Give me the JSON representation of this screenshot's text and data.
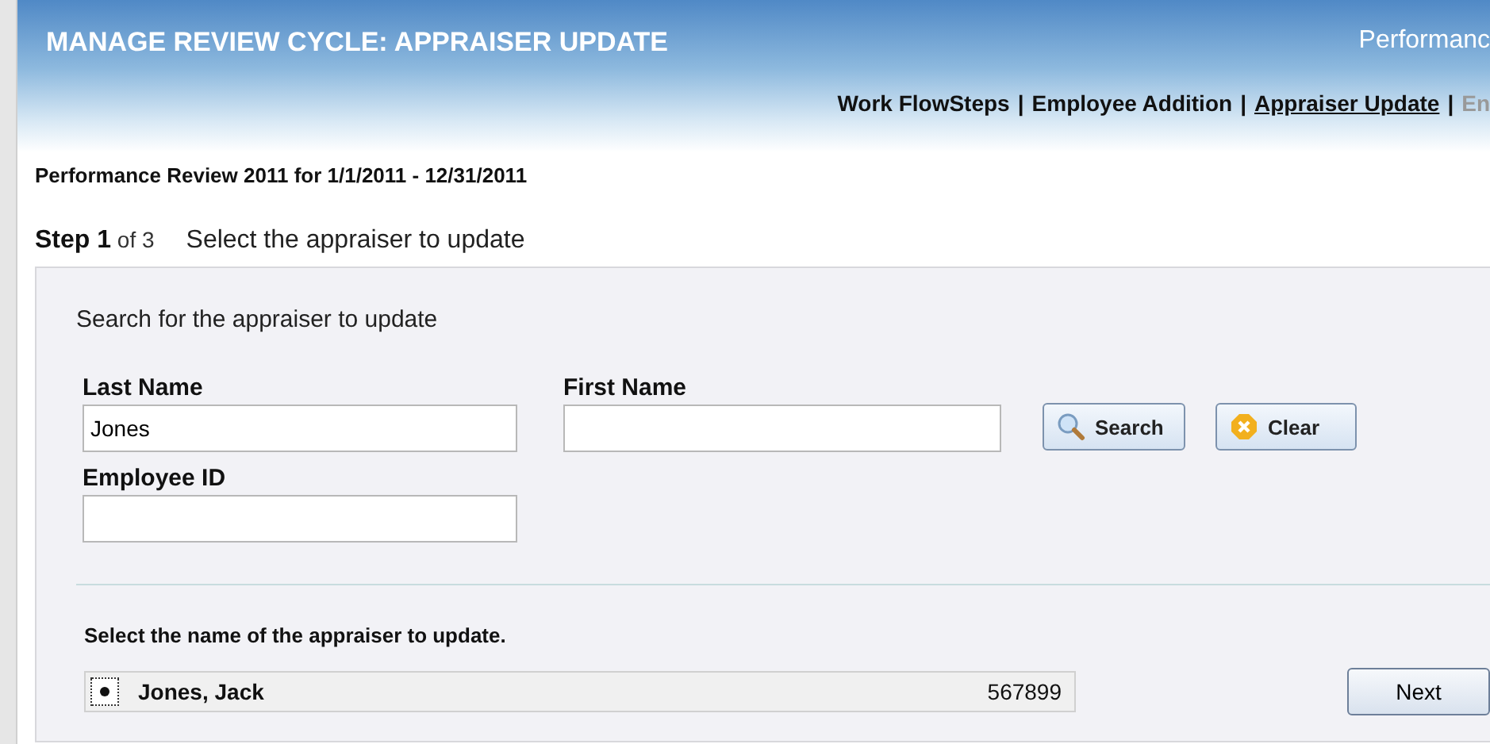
{
  "header": {
    "title": "MANAGE REVIEW CYCLE: APPRAISER UPDATE",
    "right_text": "Performanc"
  },
  "nav_separator": "|",
  "nav": [
    {
      "label": "Work FlowSteps",
      "selected": false,
      "disabled": false
    },
    {
      "label": "Employee Addition",
      "selected": false,
      "disabled": false
    },
    {
      "label": "Appraiser Update",
      "selected": true,
      "disabled": false
    },
    {
      "label": "En",
      "selected": false,
      "disabled": true
    }
  ],
  "review_title": "Performance Review 2011 for 1/1/2011 - 12/31/2011",
  "step": {
    "word": "Step",
    "number": "1",
    "of": "of 3",
    "description": "Select the appraiser to update"
  },
  "search": {
    "heading": "Search for the appraiser to update",
    "last_name": {
      "label": "Last Name",
      "value": "Jones"
    },
    "first_name": {
      "label": "First Name"
    },
    "employee_id": {
      "label": "Employee ID"
    },
    "search_button": "Search",
    "clear_button": "Clear"
  },
  "results": {
    "heading": "Select the name of the appraiser to update.",
    "rows": [
      {
        "name": "Jones, Jack",
        "id": "567899",
        "selected": true
      }
    ]
  },
  "next_button": "Next"
}
